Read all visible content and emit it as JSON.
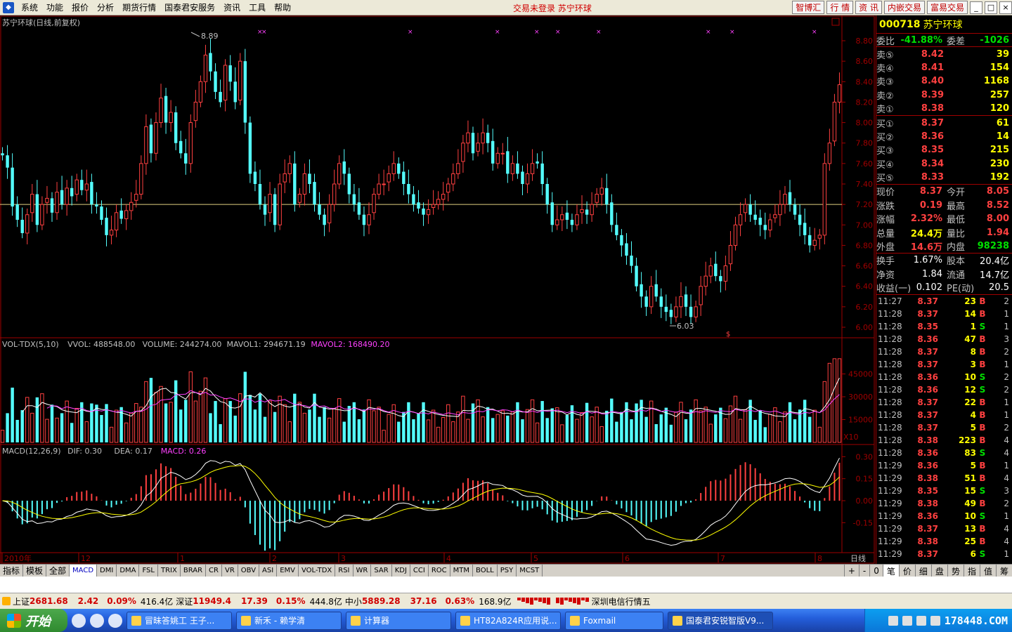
{
  "menu": [
    "系统",
    "功能",
    "报价",
    "分析",
    "期货行情",
    "国泰君安服务",
    "资讯",
    "工具",
    "帮助"
  ],
  "status_center": "交易未登录  苏宁环球",
  "right_buttons": [
    "智博汇",
    "行 情",
    "资 讯",
    "内嵌交易",
    "富易交易"
  ],
  "window_buttons": [
    "_",
    "□",
    "×"
  ],
  "chart": {
    "main_title": "苏宁环球(日线,前复权)",
    "high_label": "8.89",
    "low_label": "6.03",
    "price_axis": [
      "8.80",
      "8.60",
      "8.40",
      "8.20",
      "8.00",
      "7.80",
      "7.60",
      "7.40",
      "7.20",
      "7.00",
      "6.80",
      "6.60",
      "6.40",
      "6.20",
      "6.00"
    ],
    "vol_header": {
      "name": "VOL-TDX(5,10)",
      "vvol": "VVOL: 488548.00",
      "volume": "VOLUME: 244274.00",
      "mavol1": "MAVOL1: 294671.19",
      "mavol2": "MAVOL2: 168490.20"
    },
    "vol_axis": [
      "45000",
      "30000",
      "15000"
    ],
    "vol_unit": "X10",
    "macd_header": {
      "name": "MACD(12,26,9)",
      "dif": "DIF: 0.30",
      "dea": "DEA: 0.17",
      "macd": "MACD: 0.26"
    },
    "macd_axis": [
      "0.30",
      "0.15",
      "0.00",
      "-0.15"
    ],
    "date_axis": [
      "2010年",
      "12",
      "1",
      "2",
      "3",
      "4",
      "5",
      "6",
      "7",
      "8"
    ],
    "period_label": "日线",
    "ref_price": 7.2
  },
  "quote": {
    "code": "000718",
    "name": "苏宁环球",
    "weibi": {
      "l1": "委比",
      "v1": "-41.88%",
      "l2": "委差",
      "v2": "-1026"
    },
    "sell": [
      {
        "label": "卖⑤",
        "price": "8.42",
        "qty": "39"
      },
      {
        "label": "卖④",
        "price": "8.41",
        "qty": "154"
      },
      {
        "label": "卖③",
        "price": "8.40",
        "qty": "1168"
      },
      {
        "label": "卖②",
        "price": "8.39",
        "qty": "257"
      },
      {
        "label": "卖①",
        "price": "8.38",
        "qty": "120"
      }
    ],
    "buy": [
      {
        "label": "买①",
        "price": "8.37",
        "qty": "61"
      },
      {
        "label": "买②",
        "price": "8.36",
        "qty": "14"
      },
      {
        "label": "买③",
        "price": "8.35",
        "qty": "215"
      },
      {
        "label": "买④",
        "price": "8.34",
        "qty": "230"
      },
      {
        "label": "买⑤",
        "price": "8.33",
        "qty": "192"
      }
    ],
    "stats": [
      {
        "l1": "现价",
        "v1": "8.37",
        "c1": "#ff4040",
        "l2": "今开",
        "v2": "8.05",
        "c2": "#ff4040"
      },
      {
        "l1": "涨跌",
        "v1": "0.19",
        "c1": "#ff4040",
        "l2": "最高",
        "v2": "8.52",
        "c2": "#ff4040"
      },
      {
        "l1": "涨幅",
        "v1": "2.32%",
        "c1": "#ff4040",
        "l2": "最低",
        "v2": "8.00",
        "c2": "#ff4040"
      },
      {
        "l1": "总量",
        "v1": "24.4万",
        "c1": "#ffff00",
        "l2": "量比",
        "v2": "1.94",
        "c2": "#ff4040"
      },
      {
        "l1": "外盘",
        "v1": "14.6万",
        "c1": "#ff4040",
        "l2": "内盘",
        "v2": "98238",
        "c2": "#00e000"
      }
    ],
    "stats2": [
      {
        "l1": "换手",
        "v1": "1.67%",
        "l2": "股本",
        "v2": "20.4亿"
      },
      {
        "l1": "净资",
        "v1": "1.84",
        "l2": "流通",
        "v2": "14.7亿"
      },
      {
        "l1": "收益(一)",
        "v1": "0.102",
        "l2": "PE(动)",
        "v2": "20.5"
      }
    ],
    "ticks": [
      {
        "t": "11:27",
        "p": "8.37",
        "q": "23",
        "bs": "B",
        "n": "2"
      },
      {
        "t": "11:28",
        "p": "8.37",
        "q": "14",
        "bs": "B",
        "n": "1"
      },
      {
        "t": "11:28",
        "p": "8.35",
        "q": "1",
        "bs": "S",
        "n": "1"
      },
      {
        "t": "11:28",
        "p": "8.36",
        "q": "47",
        "bs": "B",
        "n": "3"
      },
      {
        "t": "11:28",
        "p": "8.37",
        "q": "8",
        "bs": "B",
        "n": "2"
      },
      {
        "t": "11:28",
        "p": "8.37",
        "q": "3",
        "bs": "B",
        "n": "1"
      },
      {
        "t": "11:28",
        "p": "8.36",
        "q": "10",
        "bs": "S",
        "n": "2"
      },
      {
        "t": "11:28",
        "p": "8.36",
        "q": "12",
        "bs": "S",
        "n": "2"
      },
      {
        "t": "11:28",
        "p": "8.37",
        "q": "22",
        "bs": "B",
        "n": "1"
      },
      {
        "t": "11:28",
        "p": "8.37",
        "q": "4",
        "bs": "B",
        "n": "1"
      },
      {
        "t": "11:28",
        "p": "8.37",
        "q": "5",
        "bs": "B",
        "n": "2"
      },
      {
        "t": "11:28",
        "p": "8.38",
        "q": "223",
        "bs": "B",
        "n": "4"
      },
      {
        "t": "11:28",
        "p": "8.36",
        "q": "83",
        "bs": "S",
        "n": "4"
      },
      {
        "t": "11:29",
        "p": "8.36",
        "q": "5",
        "bs": "B",
        "n": "1"
      },
      {
        "t": "11:29",
        "p": "8.38",
        "q": "51",
        "bs": "B",
        "n": "4"
      },
      {
        "t": "11:29",
        "p": "8.35",
        "q": "15",
        "bs": "S",
        "n": "3"
      },
      {
        "t": "11:29",
        "p": "8.38",
        "q": "49",
        "bs": "B",
        "n": "2"
      },
      {
        "t": "11:29",
        "p": "8.36",
        "q": "10",
        "bs": "S",
        "n": "1"
      },
      {
        "t": "11:29",
        "p": "8.37",
        "q": "13",
        "bs": "B",
        "n": "4"
      },
      {
        "t": "11:29",
        "p": "8.38",
        "q": "25",
        "bs": "B",
        "n": "4"
      },
      {
        "t": "11:29",
        "p": "8.37",
        "q": "6",
        "bs": "S",
        "n": "1"
      }
    ]
  },
  "tabs": [
    "指标",
    "模板",
    "全部",
    "MACD",
    "DMI",
    "DMA",
    "FSL",
    "TRIX",
    "BRAR",
    "CR",
    "VR",
    "OBV",
    "ASI",
    "EMV",
    "VOL-TDX",
    "RSI",
    "WR",
    "SAR",
    "KDJ",
    "CCI",
    "ROC",
    "MTM",
    "BOLL",
    "PSY",
    "MCST"
  ],
  "tab_active": "MACD",
  "tab_arrows": [
    "+",
    "-",
    "0"
  ],
  "right_tabs": [
    "笔",
    "价",
    "细",
    "盘",
    "势",
    "指",
    "值",
    "筹"
  ],
  "indexbar": [
    {
      "nm": "上证",
      "v": "2681.68",
      "ch": "2.42",
      "pct": "0.09%",
      "amt": "416.4亿"
    },
    {
      "nm": "深证",
      "v": "11949.4",
      "ch": "17.39",
      "pct": "0.15%",
      "amt": "444.8亿"
    },
    {
      "nm": "中小",
      "v": "5889.28",
      "ch": "37.16",
      "pct": "0.63%",
      "amt": "168.9亿"
    }
  ],
  "indexbar_msg": "深圳电信行情五",
  "taskbar": {
    "start": "开始",
    "tasks": [
      "冒昧答姚工 王子...",
      "新禾 - 赖学清",
      "计算器",
      "HT82A824R应用说...",
      "Foxmail",
      "国泰君安锐智版V9..."
    ],
    "watermark": "178448.COM"
  }
}
